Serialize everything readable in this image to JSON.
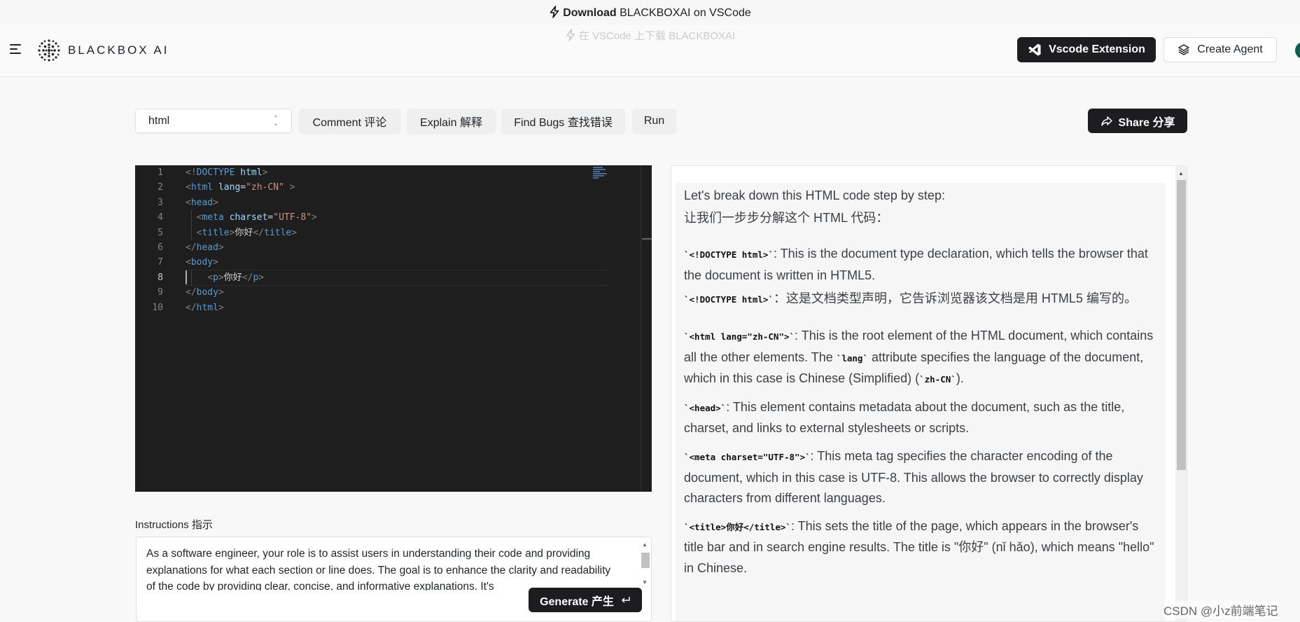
{
  "banner": {
    "download": "Download",
    "text": "BLACKBOXAI on VSCode",
    "secondary": "在 VSCode 上下载 BLACKBOXAI"
  },
  "header": {
    "logo_text": "BLACKBOX AI",
    "vscode_button": "Vscode Extension",
    "create_agent_button": "Create Agent"
  },
  "toolbar": {
    "language": "html",
    "buttons": [
      "Comment 评论",
      "Explain 解释",
      "Find Bugs 查找错误",
      "Run"
    ],
    "share_button": "Share 分享"
  },
  "editor": {
    "active_line": 8,
    "line_numbers": [
      "1",
      "2",
      "3",
      "4",
      "5",
      "6",
      "7",
      "8",
      "9",
      "10"
    ]
  },
  "instructions": {
    "label": "Instructions 指示",
    "text": "As a software engineer, your role is to assist users in understanding their code and providing explanations for what each section or line does. The goal is to enhance the clarity and readability of the code by providing clear, concise, and informative explanations. It's",
    "generate_button": "Generate 产生"
  },
  "explanation": {
    "intro_en": "Let's break down this HTML code step by step:",
    "intro_zh": "让我们一步步分解这个 HTML 代码：",
    "doctype_code": "`<!DOCTYPE html>`",
    "doctype_en": ": This is the document type declaration, which tells the browser that the document is written in HTML5.",
    "doctype_code_zh": "`<!DOCTYPE html>`",
    "doctype_zh": "：这是文档类型声明，它告诉浏览器该文档是用 HTML5 编写的。",
    "html_code": "`<html lang=\"zh-CN\">`",
    "html_en_1": ": This is the root element of the HTML document, which contains all the other elements. The ",
    "html_lang_code": "`lang`",
    "html_en_2": " attribute specifies the language of the document, which in this case is Chinese (Simplified) (",
    "html_zhcn_code": "`zh-CN`",
    "html_en_3": ").",
    "head_code": "`<head>`",
    "head_en": ": This element contains metadata about the document, such as the title, charset, and links to external stylesheets or scripts.",
    "meta_code": "`<meta charset=\"UTF-8\">`",
    "meta_en": ": This meta tag specifies the character encoding of the document, which in this case is UTF-8. This allows the browser to correctly display characters from different languages.",
    "title_code": "`<title>你好</title>`",
    "title_en": ": This sets the title of the page, which appears in the browser's title bar and in search engine results. The title is \"你好\" (nǐ hǎo), which means \"hello\" in Chinese."
  },
  "watermark": "CSDN @小z前端笔记"
}
